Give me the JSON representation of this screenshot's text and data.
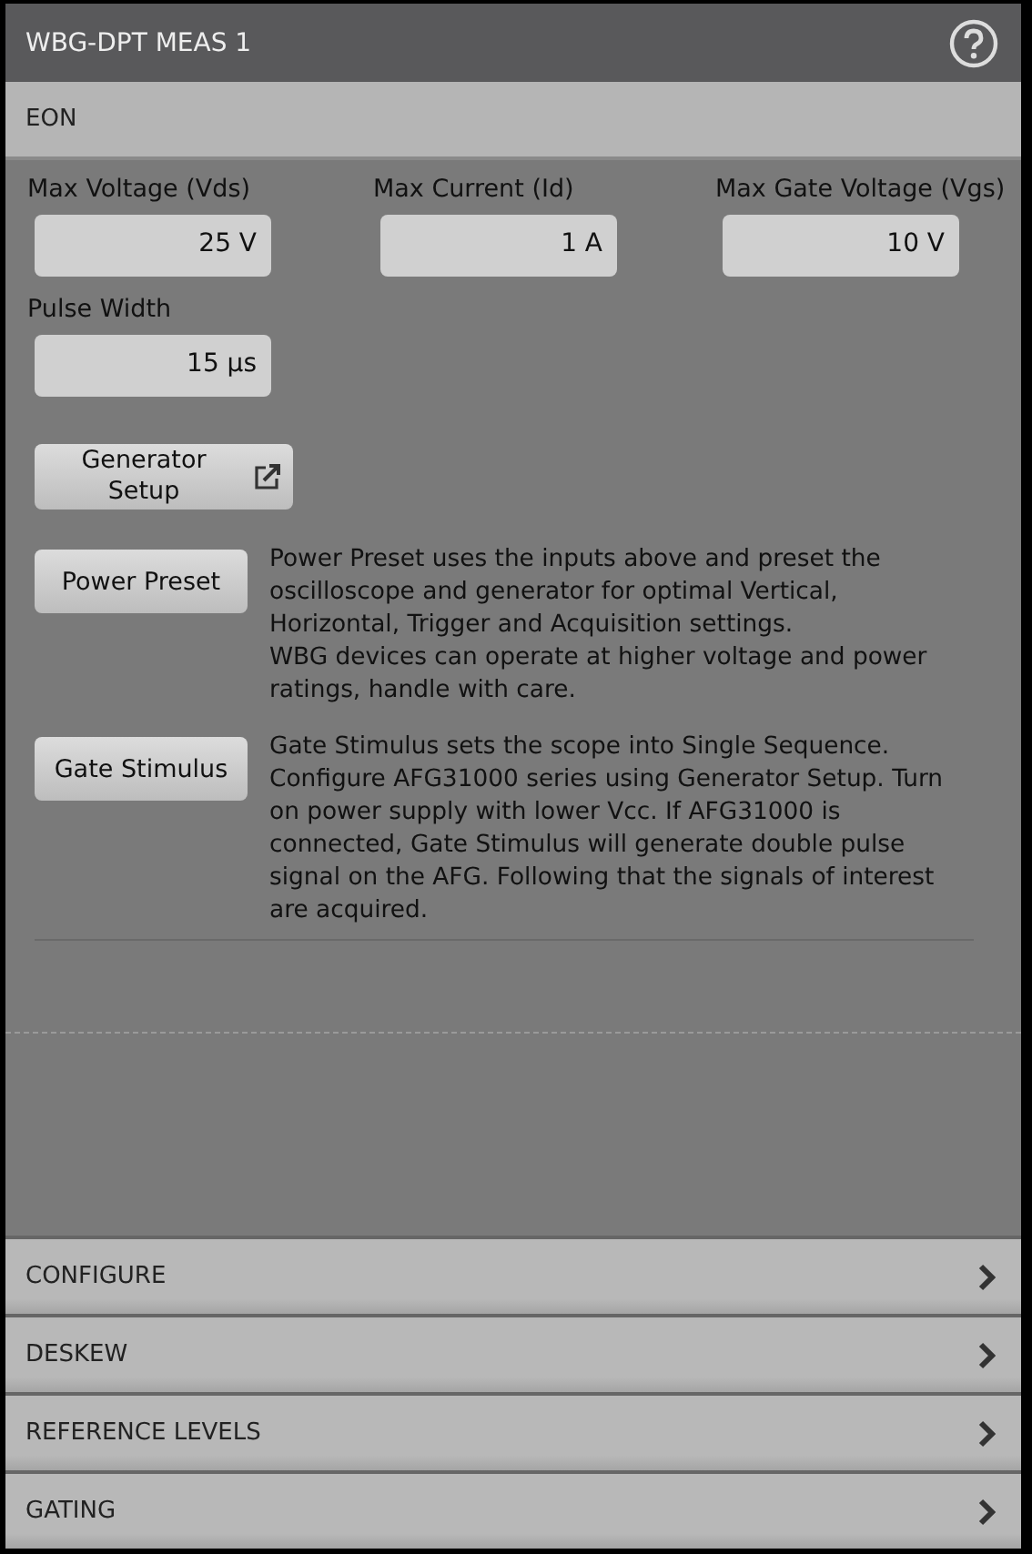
{
  "window": {
    "title": "WBG-DPT MEAS 1"
  },
  "section": {
    "title": "EON"
  },
  "fields": [
    {
      "label": "Max Voltage (Vds)",
      "value": "25 V"
    },
    {
      "label": "Max Current (Id)",
      "value": "1 A"
    },
    {
      "label": "Max Gate Voltage (Vgs)",
      "value": "10 V"
    },
    {
      "label": "Pulse Width",
      "value": "15 µs"
    }
  ],
  "generator_button": {
    "label": "Generator Setup"
  },
  "actions": [
    {
      "button": "Power Preset",
      "description": "Power Preset uses the inputs above and preset the oscilloscope and generator for optimal Vertical, Horizontal, Trigger and Acquisition settings.\nWBG devices can operate at higher voltage and power ratings, handle with care."
    },
    {
      "button": "Gate Stimulus",
      "description": "Gate Stimulus sets the scope into Single Sequence. Configure AFG31000 series using Generator Setup. Turn on power supply with lower Vcc. If AFG31000 is connected, Gate Stimulus will generate double pulse signal on the AFG. Following that the signals of interest are acquired."
    }
  ],
  "menu": [
    {
      "label": "CONFIGURE"
    },
    {
      "label": "DESKEW"
    },
    {
      "label": "REFERENCE LEVELS"
    },
    {
      "label": "GATING"
    }
  ]
}
